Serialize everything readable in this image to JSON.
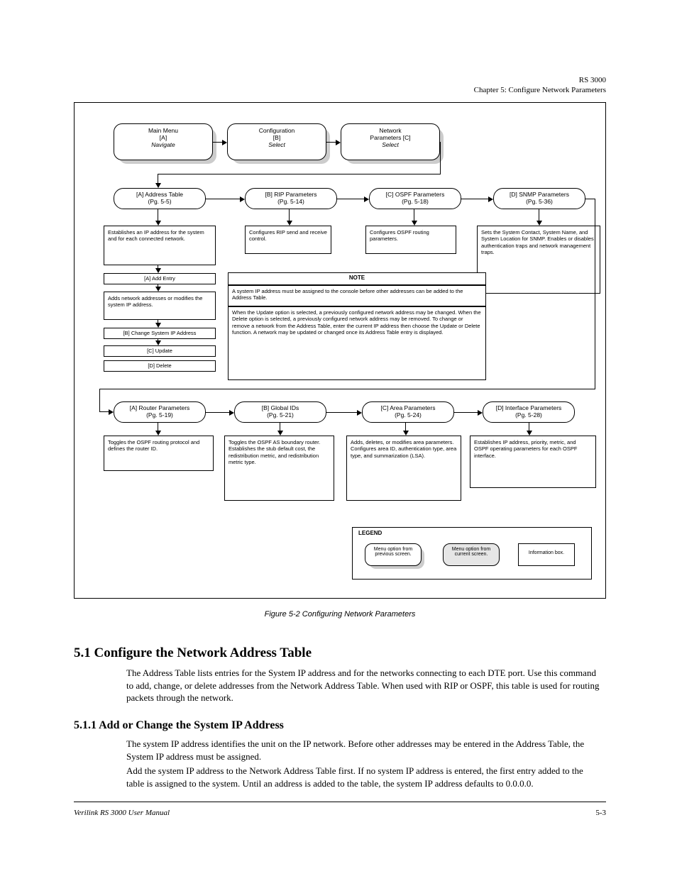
{
  "header": {
    "product": "RS 3000",
    "chapter": "Chapter 5: Configure Network Parameters"
  },
  "top": {
    "main": {
      "l1": "Main Menu",
      "l2": "[A]",
      "l3": "Navigate"
    },
    "configure": {
      "l1": "Configuration",
      "l2": "[B]",
      "l3": "Select"
    },
    "network": {
      "l1": "Network",
      "l2": "Parameters [C]",
      "l3": "Select"
    }
  },
  "row1": {
    "addr": {
      "menu": "[A] Address Table\n(Pg. 5-5)",
      "info": "Establishes an IP address for the system and for each connected network.",
      "s1": "[A] Add Entry",
      "info2": "Adds network addresses or modifies the system IP address.",
      "s2": "[B] Change System IP Address",
      "s3": "[C] Update",
      "s4": "[D] Delete"
    },
    "rip": {
      "menu": "[B] RIP Parameters\n(Pg. 5-14)",
      "info": "Configures RIP send and receive control."
    },
    "ospf": {
      "menu": "[C] OSPF Parameters\n(Pg. 5-18)",
      "info": "Configures OSPF routing parameters."
    },
    "snmp": {
      "menu": "[D] SNMP Parameters\n(Pg. 5-36)",
      "info": "Sets the System Contact, System Name, and System Location for SNMP. Enables or disables authentication traps and network management traps."
    }
  },
  "note": {
    "title": "NOTE",
    "sub": "A system IP address must be assigned to the console before other addresses can be added to the Address Table.",
    "body": "When the Update option is selected, a previously configured network address may be changed. When the Delete option is selected, a previously configured network address may be removed. To change or remove a network from the Address Table, enter the current IP address then choose the Update or Delete function. A network may be updated or changed once its Address Table entry is displayed."
  },
  "row2": {
    "rtr": {
      "menu": "[A] Router Parameters\n(Pg. 5-19)",
      "info": "Toggles the OSPF routing protocol and defines the router ID."
    },
    "ids": {
      "menu": "[B] Global IDs\n(Pg. 5-21)",
      "info": "Toggles the OSPF AS boundary router. Establishes the stub default cost, the redistribution metric, and redistribution metric type."
    },
    "area": {
      "menu": "[C] Area Parameters\n(Pg. 5-24)",
      "info": "Adds, deletes, or modifies area parameters. Configures area ID, authentication type, area type, and summarization (LSA)."
    },
    "intf": {
      "menu": "[D] Interface Parameters\n(Pg. 5-28)",
      "info": "Establishes IP address, priority, metric, and OSPF operating parameters for each OSPF interface."
    }
  },
  "legend": {
    "title": "LEGEND",
    "l1": "Menu option from\nprevious screen.",
    "l2": "Menu option from\ncurrent screen.",
    "l3": "Information box."
  },
  "caption": "Figure 5-2   Configuring Network Parameters",
  "section1": {
    "head": "5.1    Configure the Network Address Table",
    "para": "The Address Table lists entries for the System IP address and for the networks connecting to each DTE port. Use this command to add, change, or delete addresses from the Network Address Table. When used with RIP or OSPF, this table is used for routing packets through the network."
  },
  "section2": {
    "head": "5.1.1    Add or Change the System IP Address",
    "p1": "The system IP address identifies the unit on the IP network. Before other addresses may be entered in the Address Table, the System IP address must be assigned.",
    "p2": "Add the system IP address to the Network Address Table first. If no system IP address is entered, the first entry added to the table is assigned to the system. Until an address is added to the table, the system IP address defaults to 0.0.0.0."
  },
  "footer": {
    "left": "Verilink RS 3000 User Manual",
    "right": "5-3"
  }
}
